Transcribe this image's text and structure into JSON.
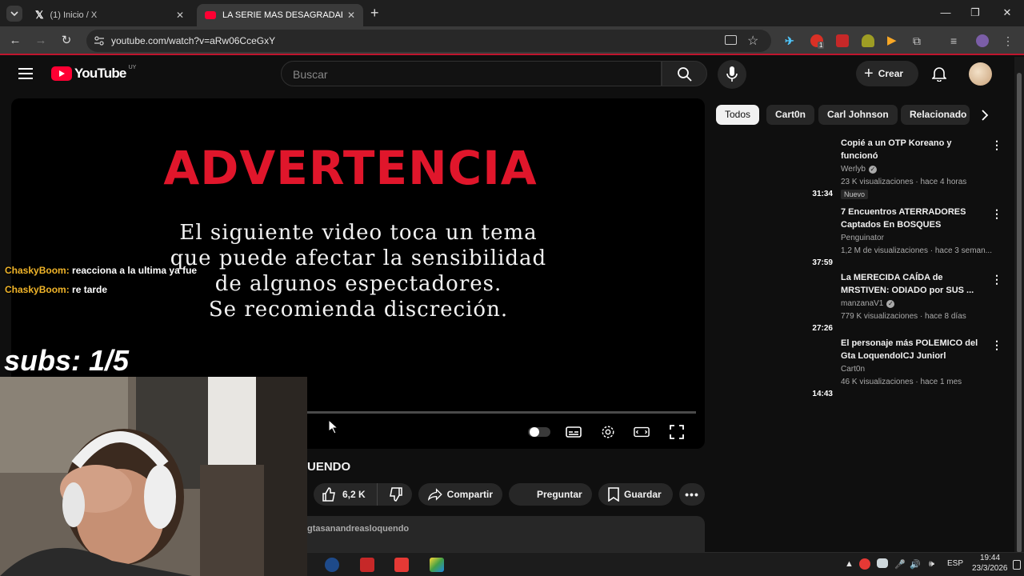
{
  "browser": {
    "tabs": [
      {
        "title": "(1) Inicio / X",
        "active": false
      },
      {
        "title": "LA SERIE MAS DESAGRADABLE",
        "active": true
      }
    ],
    "new_tab": "+",
    "url": "youtube.com/watch?v=aRw06CceGxY",
    "extension_badge": "1"
  },
  "youtube": {
    "logo_text": "YouTube",
    "country_code": "UY",
    "search_placeholder": "Buscar",
    "create_label": "Crear"
  },
  "player": {
    "warning_title": "ADVERTENCIA",
    "warning_lines": [
      "El siguiente video toca un tema",
      "que puede afectar la sensibilidad",
      "de algunos espectadores.",
      "Se recomienda discreción."
    ],
    "chat": [
      {
        "user": "ChaskyBoom:",
        "message": "reacciona a la ultima ya fue"
      },
      {
        "user": "ChaskyBoom:",
        "message": "re tarde"
      }
    ],
    "subs_overlay": "subs: 1/5"
  },
  "video": {
    "title_visible": "UENDO",
    "like_count": "6,2 K",
    "share_label": "Compartir",
    "ask_label": "Preguntar",
    "save_label": "Guardar",
    "description_snippet": "gtasanandreasloquendo"
  },
  "chips": [
    "Todos",
    "Cart0n",
    "Carl Johnson",
    "Relacionado"
  ],
  "recommendations": [
    {
      "title": "Copié a un OTP Koreano y funcionó",
      "channel": "Werlyb",
      "verified": true,
      "meta": "23 K visualizaciones · hace 4 horas",
      "badge": "Nuevo",
      "duration": "31:34"
    },
    {
      "title": "7 Encuentros ATERRADORES Captados En BOSQUES",
      "channel": "Penguinator",
      "verified": false,
      "meta": "1,2 M de visualizaciones · hace 3 seman...",
      "badge": "",
      "duration": "37:59"
    },
    {
      "title": "La MERECIDA CAÍDA de MRSTIVEN: ODIADO por SUS ...",
      "channel": "manzanaV1",
      "verified": true,
      "meta": "779 K visualizaciones · hace 8 días",
      "badge": "",
      "duration": "27:26"
    },
    {
      "title": "El personaje más POLEMICO del Gta LoquendoICJ Juniorl",
      "channel": "Cart0n",
      "verified": false,
      "meta": "46 K visualizaciones · hace 1 mes",
      "badge": "",
      "duration": "14:43"
    }
  ],
  "taskbar": {
    "language": "ESP",
    "time": "19:44",
    "date": "23/3/2026"
  },
  "colors": {
    "accent_red": "#e0162b",
    "chat_user": "#f0b429",
    "background": "#0f0f0f"
  }
}
